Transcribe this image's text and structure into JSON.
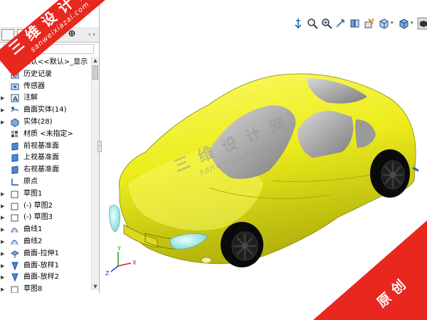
{
  "tree": {
    "tabs": [
      "FeatureManager",
      "PropertyManager",
      "ConfigurationManager",
      "DimXpertManager"
    ],
    "tab_glyphs": [
      "",
      "",
      "",
      "⊕"
    ],
    "items": [
      {
        "label": "默认<<默认>_显示",
        "icon": "display-state-icon",
        "expandable": false
      },
      {
        "label": "历史记录",
        "icon": "history-icon",
        "expandable": false
      },
      {
        "label": "传感器",
        "icon": "sensor-icon",
        "expandable": false
      },
      {
        "label": "注解",
        "icon": "annotation-icon",
        "expandable": true
      },
      {
        "label": "曲面实体(14)",
        "icon": "surface-body-icon",
        "expandable": true
      },
      {
        "label": "实体(28)",
        "icon": "solid-body-icon",
        "expandable": true
      },
      {
        "label": "材质 <未指定>",
        "icon": "material-icon",
        "expandable": false
      },
      {
        "label": "前视基准面",
        "icon": "plane-icon",
        "expandable": false
      },
      {
        "label": "上视基准面",
        "icon": "plane-icon",
        "expandable": false
      },
      {
        "label": "右视基准面",
        "icon": "plane-icon",
        "expandable": false
      },
      {
        "label": "原点",
        "icon": "origin-icon",
        "expandable": false
      },
      {
        "label": "草图1",
        "icon": "sketch-icon",
        "expandable": true
      },
      {
        "label": "(-) 草图2",
        "icon": "sketch-icon",
        "expandable": true
      },
      {
        "label": "(-) 草图3",
        "icon": "sketch-icon",
        "expandable": true
      },
      {
        "label": "曲线1",
        "icon": "curve-icon",
        "expandable": true
      },
      {
        "label": "曲线2",
        "icon": "curve-icon",
        "expandable": true
      },
      {
        "label": "曲面-拉伸1",
        "icon": "surface-extrude-icon",
        "expandable": true
      },
      {
        "label": "曲面-放样1",
        "icon": "surface-loft-icon",
        "expandable": true
      },
      {
        "label": "曲面-放样2",
        "icon": "surface-loft-icon",
        "expandable": true
      },
      {
        "label": "草图8",
        "icon": "sketch-icon",
        "expandable": true
      }
    ]
  },
  "toolbar": {
    "buttons": [
      {
        "name": "view-orientation-button",
        "icon": "anchor-icon"
      },
      {
        "name": "zoom-to-fit-button",
        "icon": "zoom-fit-icon"
      },
      {
        "name": "zoom-to-area-button",
        "icon": "zoom-area-icon"
      },
      {
        "name": "previous-view-button",
        "icon": "previous-view-icon"
      },
      {
        "name": "section-view-button",
        "icon": "section-view-icon"
      },
      {
        "name": "dynamic-annotation-button",
        "icon": "annotation-view-icon"
      },
      {
        "name": "view-orientation-dropdown",
        "icon": "cube-view-icon"
      },
      {
        "name": "display-style-dropdown",
        "icon": "display-style-icon"
      },
      {
        "name": "hide-show-button",
        "icon": "hide-show-icon"
      }
    ]
  },
  "model": {
    "body_color": "#f0f020",
    "glass_color": "#a8a8a8",
    "headlight_color": "#9ee8e8",
    "tire_color": "#0a0a0a"
  },
  "triad": {
    "x": "X",
    "y": "Y",
    "z": "Z"
  },
  "watermark": {
    "title": "三维设计网",
    "url": "sanweixiazai.com",
    "corner": "原创",
    "accent": "#e8271e"
  }
}
